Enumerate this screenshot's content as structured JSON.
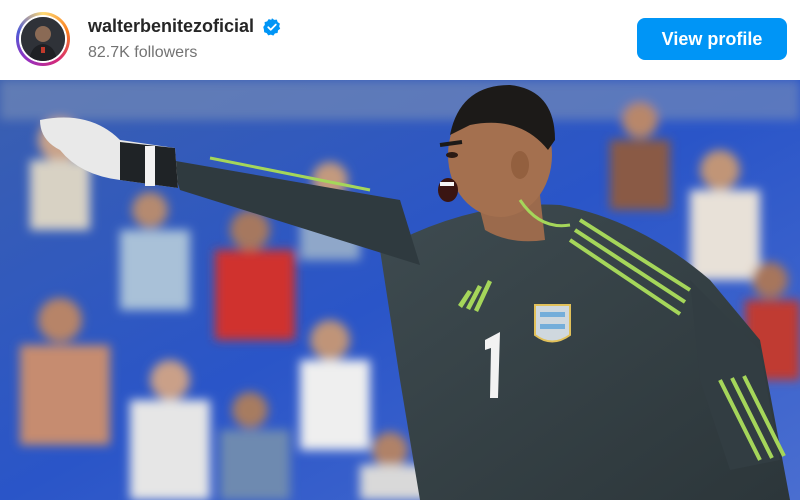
{
  "profile": {
    "username": "walterbenitezoficial",
    "followers": "82.7K followers",
    "verified": true,
    "avatar_icon": "avatar"
  },
  "actions": {
    "view_profile": "View profile"
  },
  "post_image": {
    "subject": "goalkeeper-photo",
    "jersey_number": "1",
    "colors": {
      "jersey": "#39454a",
      "stripe": "#a5d65a",
      "crowd_blue": "#2f5fc0",
      "button": "#0095f6"
    }
  }
}
